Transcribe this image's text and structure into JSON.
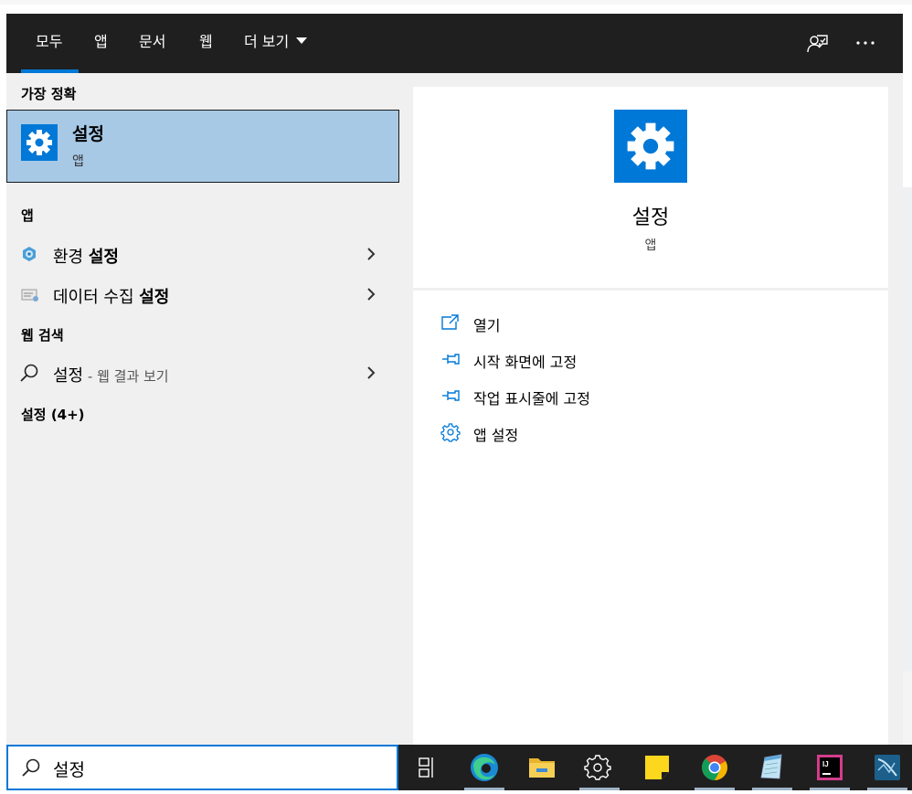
{
  "topbar": {
    "tabs": [
      {
        "label": "모두",
        "active": true
      },
      {
        "label": "앱"
      },
      {
        "label": "문서"
      },
      {
        "label": "웹"
      },
      {
        "label": "더 보기"
      }
    ],
    "accent": "#0078d7"
  },
  "left": {
    "best_match_header": "가장 정확",
    "best_match": {
      "title": "설정",
      "subtitle": "앱"
    },
    "apps_header": "앱",
    "apps": [
      {
        "plain": "환경 ",
        "bold": "설정",
        "icon": "control-panel-icon"
      },
      {
        "plain": "데이터 수집 ",
        "bold": "설정",
        "icon": "data-collection-icon"
      }
    ],
    "web_header": "웹 검색",
    "web_item": {
      "query": "설정",
      "suffix": " - 웹 결과 보기"
    },
    "settings_header": "설정 (4+)"
  },
  "detail": {
    "title": "설정",
    "subtitle": "앱",
    "actions": [
      {
        "label": "열기",
        "icon": "open-icon"
      },
      {
        "label": "시작 화면에 고정",
        "icon": "pin-icon"
      },
      {
        "label": "작업 표시줄에 고정",
        "icon": "pin-icon"
      },
      {
        "label": "앱 설정",
        "icon": "gear-icon"
      }
    ]
  },
  "search": {
    "value": "설정"
  },
  "taskbar": {
    "items": [
      "task-view-icon",
      "edge-icon",
      "file-explorer-icon",
      "settings-icon",
      "sticky-notes-icon",
      "chrome-icon",
      "notepad-icon",
      "intellij-icon",
      "mysql-workbench-icon"
    ]
  }
}
